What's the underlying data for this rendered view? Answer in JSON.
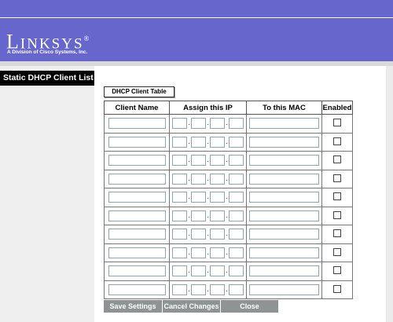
{
  "brand": {
    "logo_large": "L",
    "logo_small": "INKSYS",
    "logo_mark": "®",
    "subtitle": "A Division of Cisco Systems, Inc."
  },
  "sidebar": {
    "title": "Static DHCP Client List"
  },
  "dhcp_client_table_label": "DHCP Client Table",
  "table": {
    "columns": [
      "Client Name",
      "Assign this IP",
      "To this MAC",
      "Enabled"
    ],
    "row_count": 10
  },
  "actions": {
    "save": "Save Settings",
    "cancel": "Cancel Changes",
    "close": "Close"
  },
  "colors": {
    "brand_band": "#6666cc",
    "sidebar_title_bg": "#000000",
    "action_button_bg": "#8e9493"
  }
}
